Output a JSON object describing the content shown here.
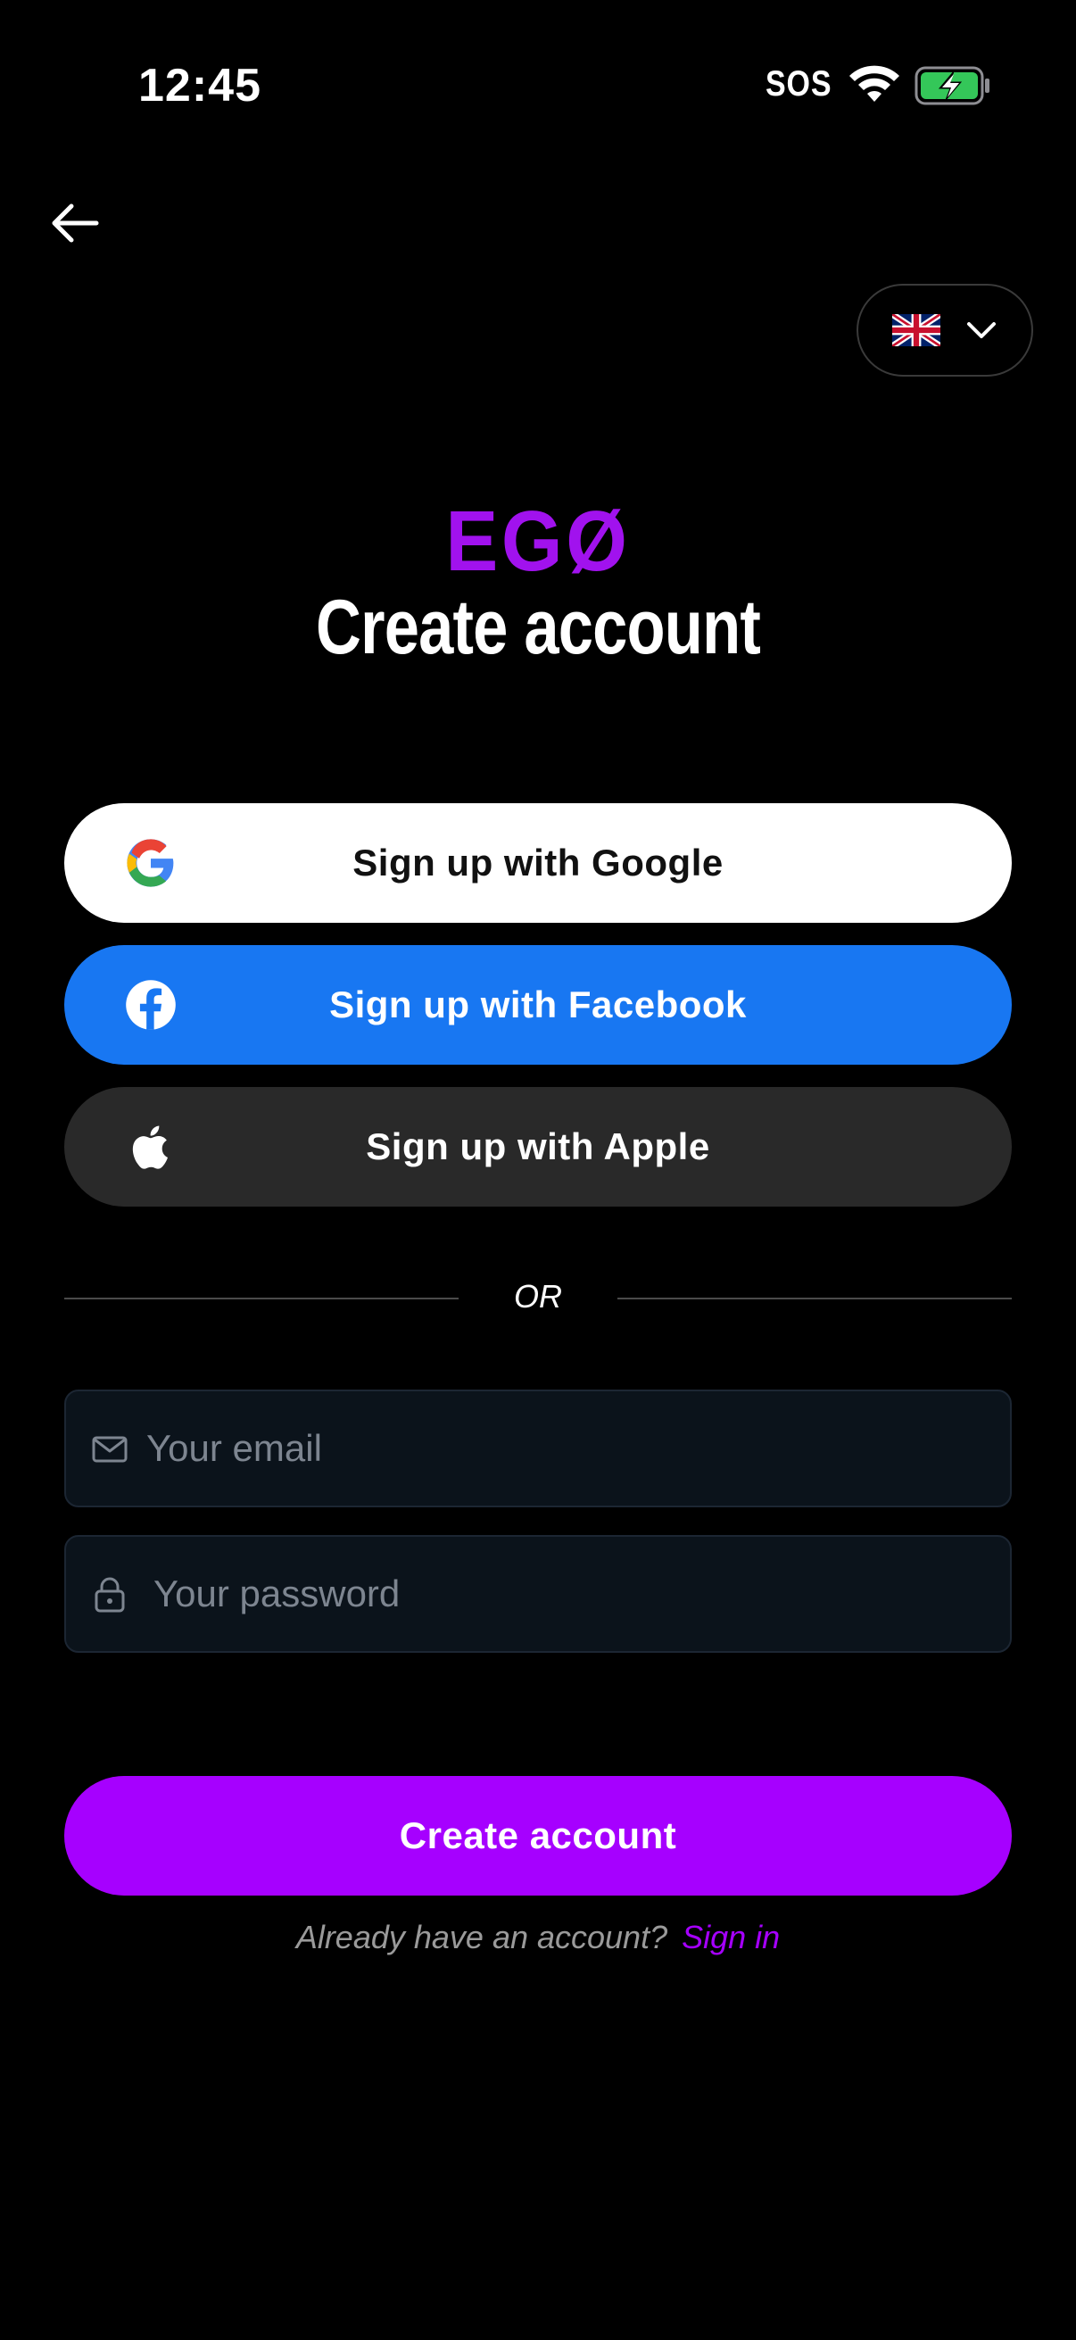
{
  "status_bar": {
    "time": "12:45",
    "carrier": "SOS",
    "battery_color": "#34c759"
  },
  "header": {
    "language": "English (UK)",
    "logo": "EGØ",
    "title": "Create account"
  },
  "social": {
    "google_label": "Sign up with Google",
    "facebook_label": "Sign up with Facebook",
    "apple_label": "Sign up with Apple"
  },
  "divider": {
    "text": "OR"
  },
  "form": {
    "email_placeholder": "Your email",
    "email_value": "",
    "password_placeholder": "Your password",
    "password_value": "",
    "submit_label": "Create account"
  },
  "footer": {
    "prompt": "Already have an account?",
    "link": "Sign in"
  },
  "colors": {
    "brand": "#a600ff",
    "facebook": "#1877f2",
    "apple_button": "#292929",
    "input_bg": "#0b131b"
  },
  "icons": [
    "back-arrow-icon",
    "uk-flag-icon",
    "chevron-down-icon",
    "google-icon",
    "facebook-icon",
    "apple-icon",
    "mail-icon",
    "lock-icon",
    "wifi-icon",
    "battery-charging-icon"
  ]
}
